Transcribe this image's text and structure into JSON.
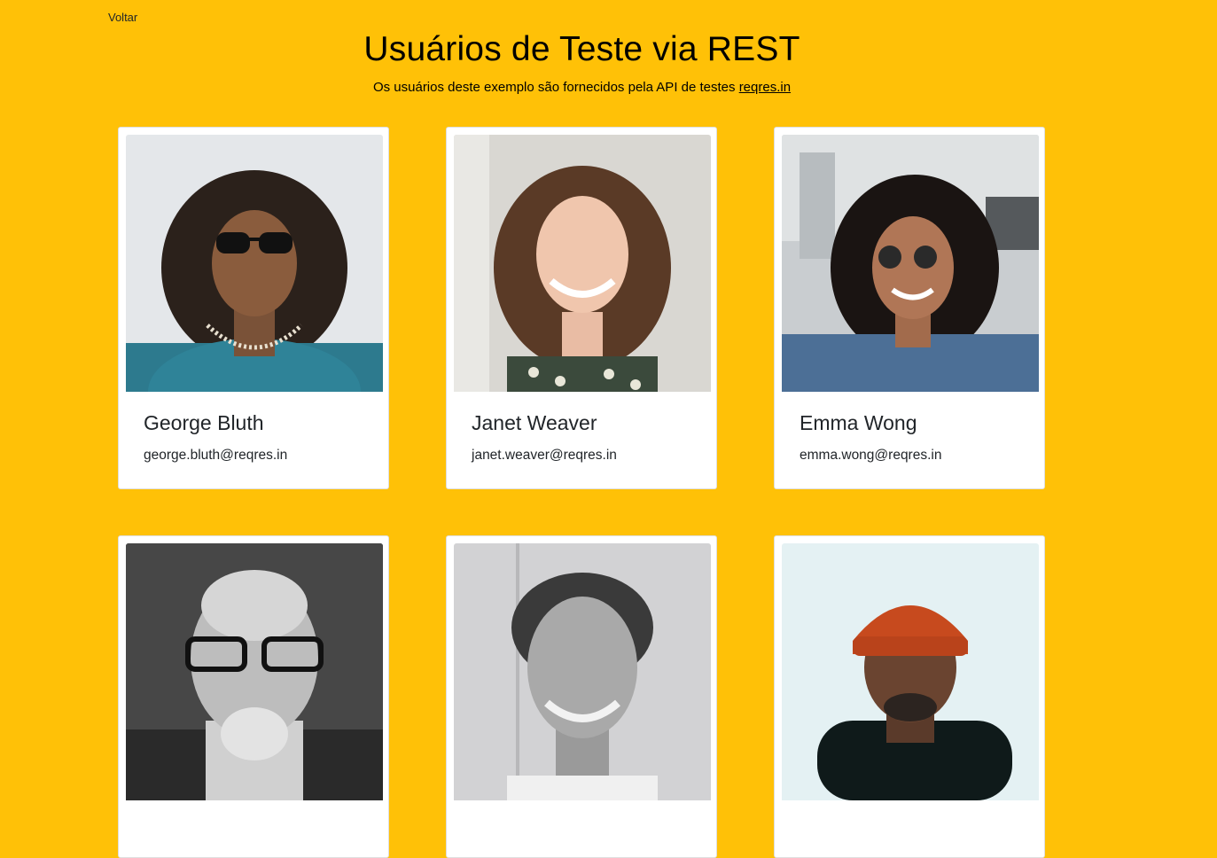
{
  "nav": {
    "back_label": "Voltar"
  },
  "header": {
    "title": "Usuários de Teste via REST",
    "subtitle_prefix": "Os usuários deste exemplo são fornecidos pela API de testes ",
    "subtitle_link": "reqres.in"
  },
  "users": [
    {
      "name": "George Bluth",
      "email": "george.bluth@reqres.in",
      "photo": "avatar-photo"
    },
    {
      "name": "Janet Weaver",
      "email": "janet.weaver@reqres.in",
      "photo": "avatar-photo"
    },
    {
      "name": "Emma Wong",
      "email": "emma.wong@reqres.in",
      "photo": "avatar-photo"
    },
    {
      "name": "",
      "email": "",
      "photo": "avatar-photo"
    },
    {
      "name": "",
      "email": "",
      "photo": "avatar-photo"
    },
    {
      "name": "",
      "email": "",
      "photo": "avatar-photo"
    }
  ],
  "colors": {
    "page_background": "#FFC107",
    "card_background": "#FFFFFF",
    "text": "#212529"
  }
}
